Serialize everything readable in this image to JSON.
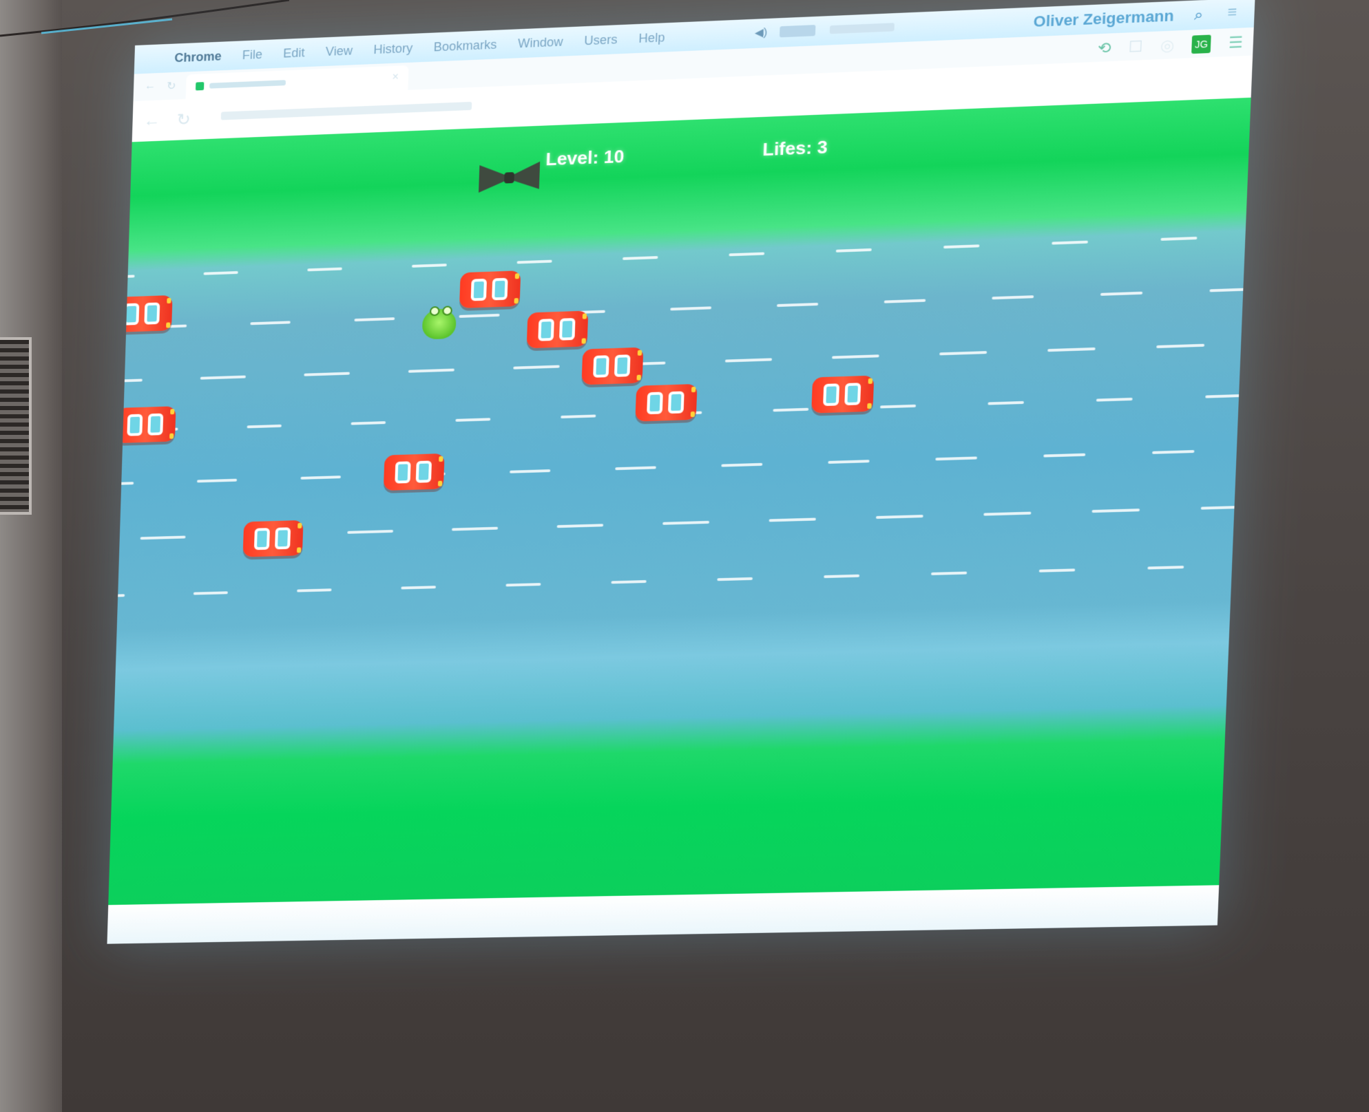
{
  "menubar": {
    "apple_glyph": "",
    "app_name": "Chrome",
    "items": [
      "File",
      "Edit",
      "View",
      "History",
      "Bookmarks",
      "Window",
      "Users",
      "Help"
    ],
    "user_name": "Oliver Zeigermann",
    "icons": [
      "volume-icon",
      "battery-icon",
      "search-icon",
      "list-icon"
    ]
  },
  "toolbar": {
    "icons": [
      "back-icon",
      "reload-icon",
      "refresh-icon",
      "bookmark-icon",
      "extension-icon",
      "menu-icon"
    ],
    "extension_label": "JG"
  },
  "game": {
    "level_label": "Level: 10",
    "lifes_label": "Lifes: 3",
    "level": 10,
    "lifes": 3,
    "colors": {
      "grass": "#0fd45c",
      "road": "#63b6d2",
      "car": "#ff4a2c",
      "frog": "#7bdc3c"
    }
  }
}
